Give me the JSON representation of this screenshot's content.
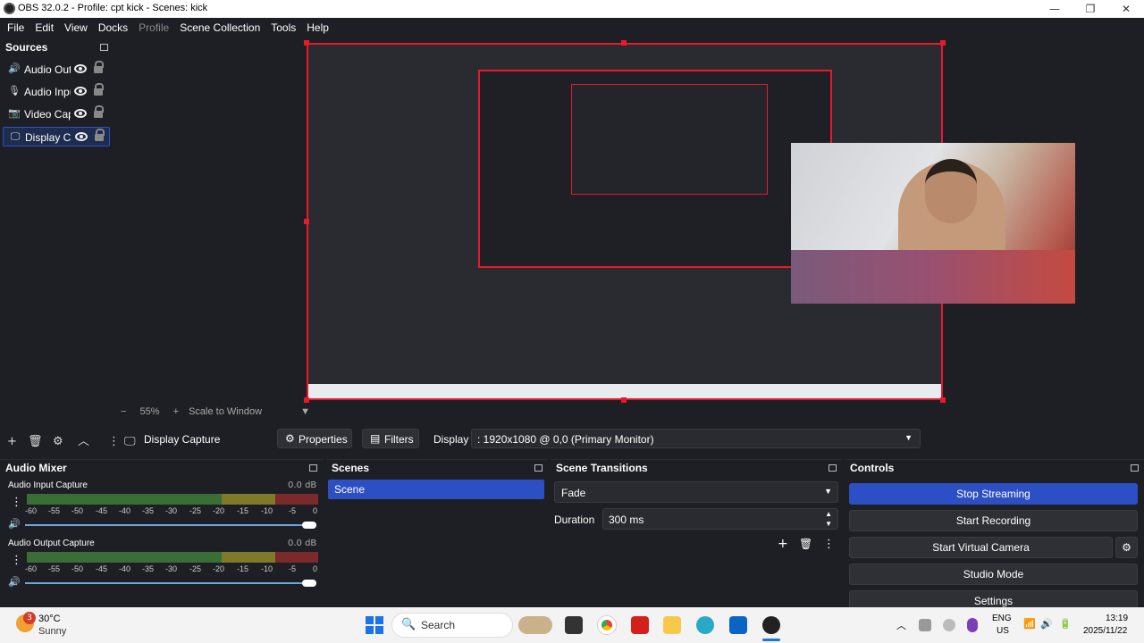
{
  "window": {
    "title": "OBS 32.0.2 - Profile: cpt kick - Scenes: kick",
    "min": "—",
    "max": "❐",
    "close": "✕"
  },
  "menu": {
    "file": "File",
    "edit": "Edit",
    "view": "View",
    "docks": "Docks",
    "profile": "Profile",
    "scene_collection": "Scene Collection",
    "tools": "Tools",
    "help": "Help"
  },
  "sources": {
    "title": "Sources",
    "items": [
      {
        "label": "Audio Output Capture",
        "icon": "speaker-icon"
      },
      {
        "label": "Audio Input Capture",
        "icon": "microphone-icon"
      },
      {
        "label": "Video Capture Device",
        "icon": "camera-icon"
      },
      {
        "label": "Display Capture",
        "icon": "monitor-icon"
      }
    ]
  },
  "preview": {
    "zoom_minus": "−",
    "zoom": "55%",
    "zoom_plus": "+",
    "scale": "Scale to Window"
  },
  "source_toolbar": {
    "selected_source": "Display Capture",
    "properties": "Properties",
    "filters": "Filters",
    "display_label": "Display",
    "display_value": ": 1920x1080 @ 0,0 (Primary Monitor)"
  },
  "audio_mixer": {
    "title": "Audio Mixer",
    "channels": [
      {
        "name": "Audio Input Capture",
        "level": "0.0 dB"
      },
      {
        "name": "Audio Output Capture",
        "level": "0.0 dB"
      }
    ],
    "ticks": [
      "-60",
      "-55",
      "-50",
      "-45",
      "-40",
      "-35",
      "-30",
      "-25",
      "-20",
      "-15",
      "-10",
      "-5",
      "0"
    ]
  },
  "scenes": {
    "title": "Scenes",
    "items": [
      "Scene"
    ]
  },
  "transitions": {
    "title": "Scene Transitions",
    "type": "Fade",
    "duration_label": "Duration",
    "duration_value": "300 ms"
  },
  "controls": {
    "title": "Controls",
    "stop_streaming": "Stop Streaming",
    "start_recording": "Start Recording",
    "start_virtual_camera": "Start Virtual Camera",
    "studio_mode": "Studio Mode",
    "settings": "Settings"
  },
  "taskbar": {
    "weather_temp": "30°C",
    "weather_desc": "Sunny",
    "weather_badge": "3",
    "search": "Search",
    "lang1": "ENG",
    "lang2": "US",
    "time": "13:19",
    "date": "2025/11/22"
  },
  "colors": {
    "accent": "#2d4fc4",
    "record_red": "#e8192c",
    "bg": "#1e1f24"
  }
}
